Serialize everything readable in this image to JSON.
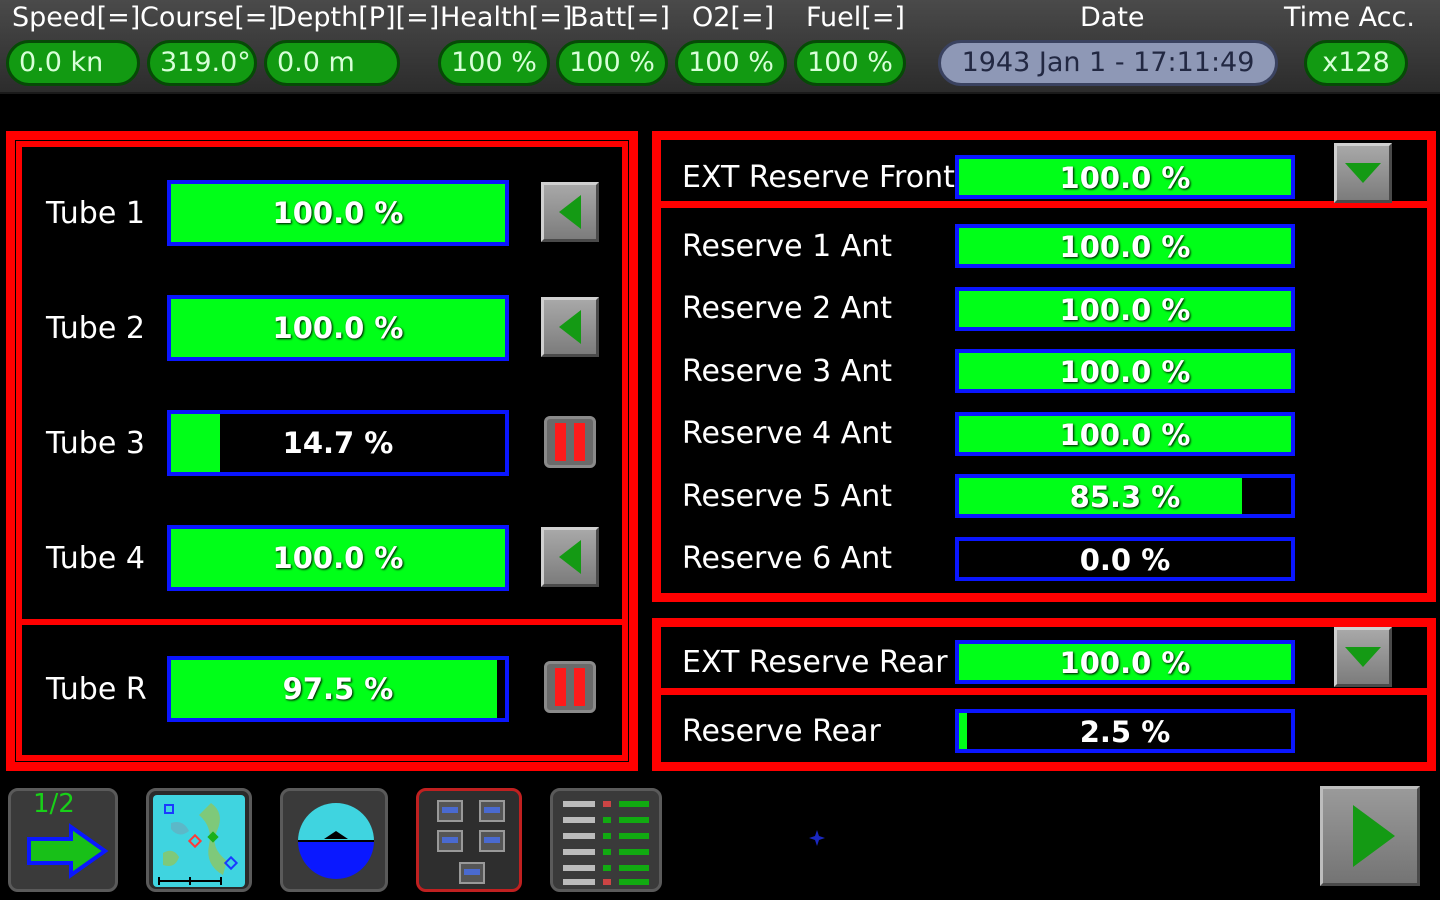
{
  "status_bar": {
    "speed": {
      "label": "Speed[=]",
      "value": "0.0 kn"
    },
    "course": {
      "label": "Course[=]",
      "value": "319.0°"
    },
    "depth": {
      "label": "Depth[P][=]",
      "value": "0.0 m"
    },
    "health": {
      "label": "Health[=]",
      "value": "100 %"
    },
    "batt": {
      "label": "Batt[=]",
      "value": "100 %"
    },
    "o2": {
      "label": "O2[=]",
      "value": "100 %"
    },
    "fuel": {
      "label": "Fuel[=]",
      "value": "100 %"
    },
    "date": {
      "label": "Date",
      "value": "1943 Jan 1 - 17:11:49"
    },
    "time_acc": {
      "label": "Time Acc.",
      "value": "x128"
    }
  },
  "tubes": {
    "rows": [
      {
        "label": "Tube 1",
        "percent_text": "100.0 %",
        "fill": 1.0,
        "control": "eject-left"
      },
      {
        "label": "Tube 2",
        "percent_text": "100.0 %",
        "fill": 1.0,
        "control": "eject-left"
      },
      {
        "label": "Tube 3",
        "percent_text": "14.7 %",
        "fill": 0.147,
        "control": "pause"
      },
      {
        "label": "Tube 4",
        "percent_text": "100.0 %",
        "fill": 1.0,
        "control": "eject-left"
      }
    ],
    "rear": {
      "label": "Tube R",
      "percent_text": "97.5 %",
      "fill": 0.975,
      "control": "pause"
    }
  },
  "reserves_front": {
    "ext": {
      "label": "EXT Reserve Front",
      "percent_text": "100.0 %",
      "fill": 1.0
    },
    "rows": [
      {
        "label": "Reserve 1 Ant",
        "percent_text": "100.0 %",
        "fill": 1.0
      },
      {
        "label": "Reserve 2 Ant",
        "percent_text": "100.0 %",
        "fill": 1.0
      },
      {
        "label": "Reserve 3 Ant",
        "percent_text": "100.0 %",
        "fill": 1.0
      },
      {
        "label": "Reserve 4 Ant",
        "percent_text": "100.0 %",
        "fill": 1.0
      },
      {
        "label": "Reserve 5 Ant",
        "percent_text": "85.3 %",
        "fill": 0.853
      },
      {
        "label": "Reserve 6 Ant",
        "percent_text": "0.0 %",
        "fill": 0.0
      }
    ]
  },
  "reserves_rear": {
    "ext": {
      "label": "EXT Reserve Rear",
      "percent_text": "100.0 %",
      "fill": 1.0
    },
    "row": {
      "label": "Reserve Rear",
      "percent_text": "2.5 %",
      "fill": 0.025
    }
  },
  "bottom_bar": {
    "page_indicator": "1/2"
  },
  "colors": {
    "frame": "#ff0000",
    "bar_fill": "#00ff18",
    "bar_border": "#0a16ff",
    "pill_green": "#129a12",
    "pause_red": "#ff1a1a"
  }
}
